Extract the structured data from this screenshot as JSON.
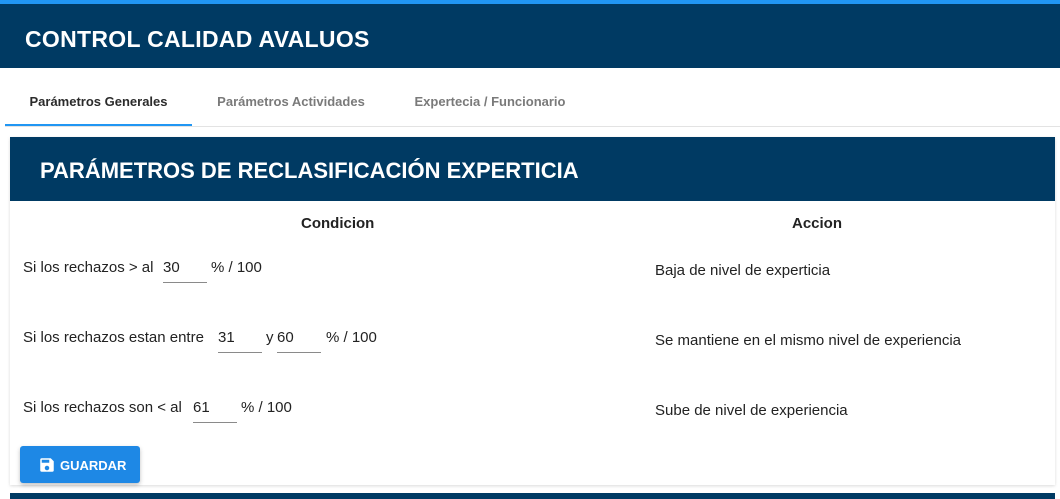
{
  "header": {
    "title": "CONTROL CALIDAD AVALUOS"
  },
  "tabs": [
    {
      "label": "Parámetros Generales",
      "active": true
    },
    {
      "label": "Parámetros Actividades",
      "active": false
    },
    {
      "label": "Expertecia / Funcionario",
      "active": false
    }
  ],
  "panel": {
    "title": "PARÁMETROS DE RECLASIFICACIÓN EXPERTICIA",
    "columns": {
      "condicion": "Condicion",
      "accion": "Accion"
    },
    "rows": [
      {
        "prefix": "Si los rechazos > al",
        "value1": "30",
        "suffix": "% / 100",
        "accion": "Baja de nivel de experticia"
      },
      {
        "prefix": "Si los rechazos estan entre",
        "value1": "31",
        "connector": "y",
        "value2": "60",
        "suffix": "% / 100",
        "accion": "Se mantiene en el mismo nivel de experiencia"
      },
      {
        "prefix": "Si los rechazos son < al",
        "value1": "61",
        "suffix": "% / 100",
        "accion": "Sube de nivel de experiencia"
      }
    ]
  },
  "actions": {
    "save_label": "GUARDAR",
    "save_icon": "floppy-disk-icon"
  },
  "colors": {
    "primary_dark": "#003a63",
    "accent": "#2196f3",
    "button": "#1e88e5"
  }
}
